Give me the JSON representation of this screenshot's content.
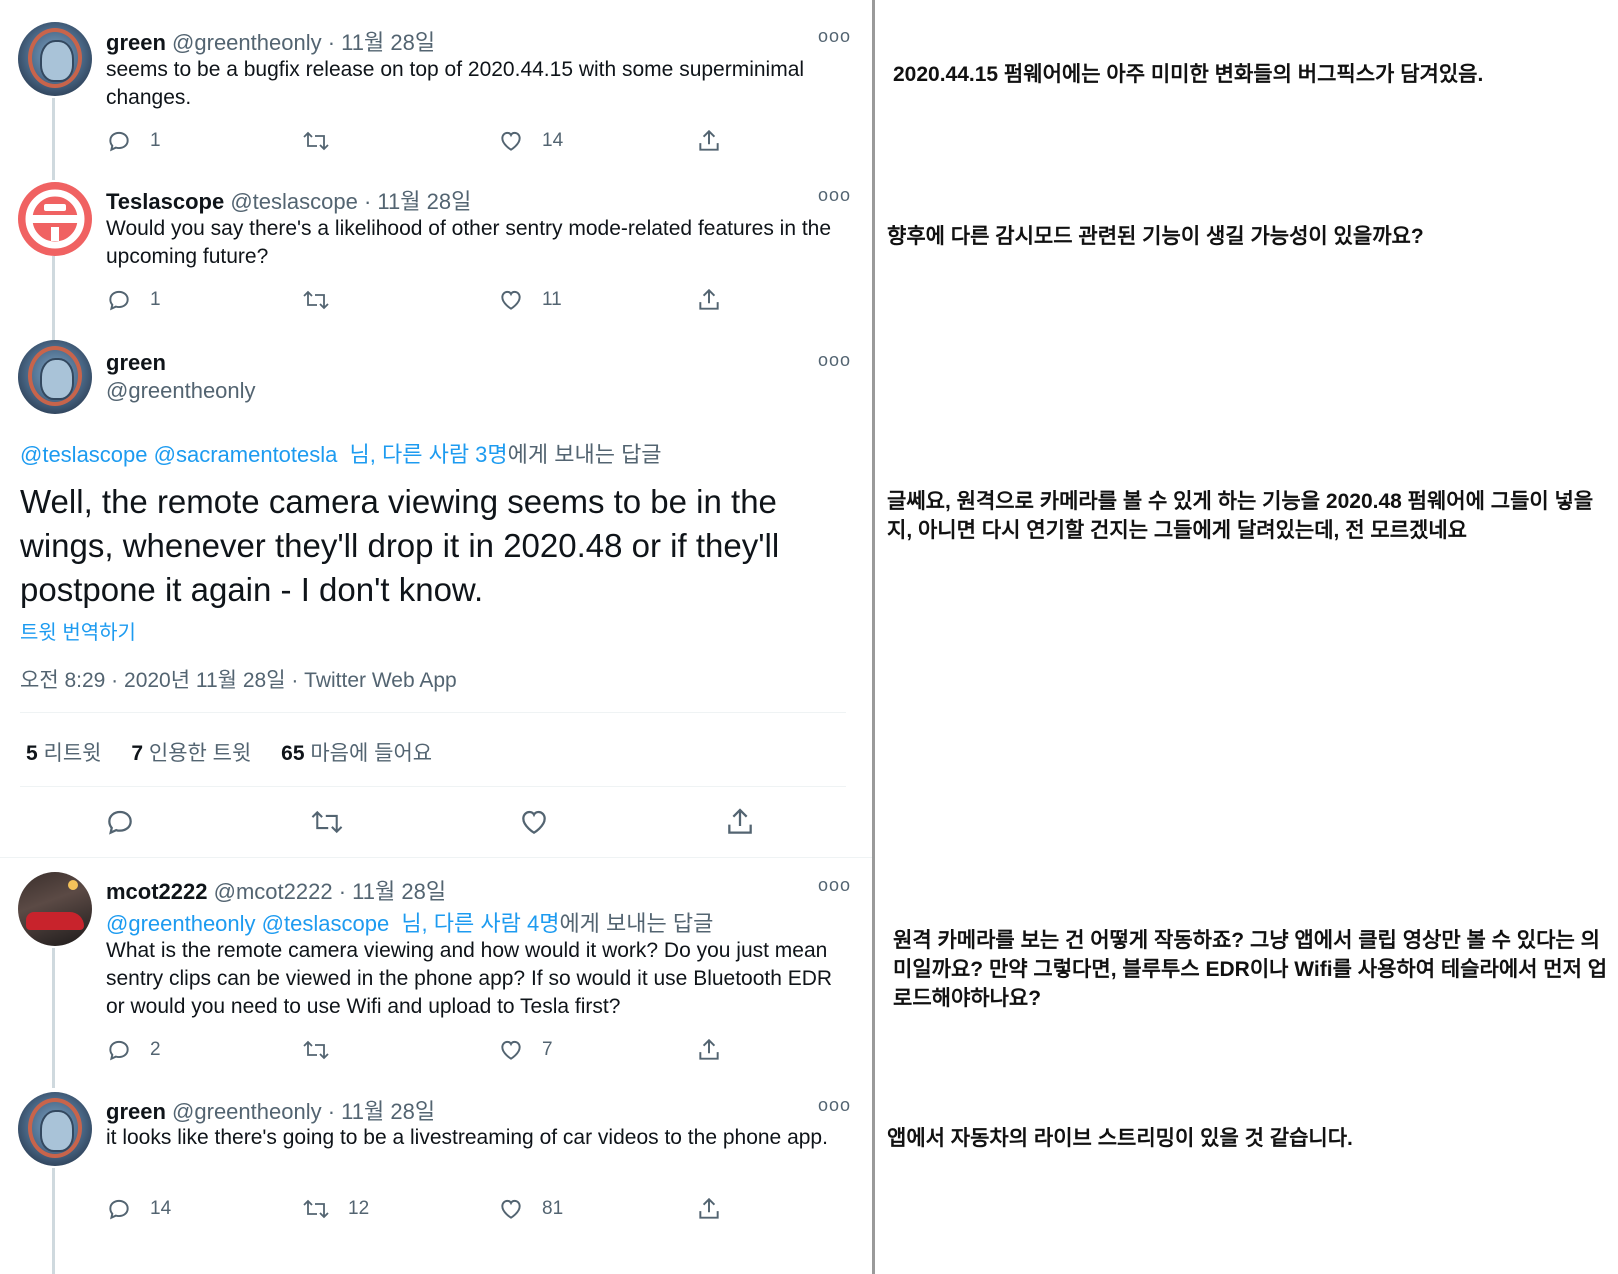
{
  "tweets": {
    "t1": {
      "name": "green",
      "handle": "@greentheonly",
      "date": "11월 28일",
      "text": "seems to be a bugfix release on top of 2020.44.15 with some superminimal changes.",
      "replies": "1",
      "retweets": "",
      "likes": "14"
    },
    "t2": {
      "name": "Teslascope",
      "handle": "@teslascope",
      "date": "11월 28일",
      "text": "Would you say there's a likelihood of other sentry mode-related features in the upcoming future?",
      "replies": "1",
      "retweets": "",
      "likes": "11"
    },
    "main": {
      "name": "green",
      "handle": "@greentheonly",
      "reply_mention1": "@teslascope",
      "reply_mention2": "@sacramentotesla",
      "reply_link": "님, 다른 사람 3명",
      "reply_suffix": "에게 보내는 답글",
      "text": "Well, the remote camera viewing seems to be in the wings, whenever they'll drop it in 2020.48 or if they'll postpone it again - I don't know.",
      "translate": "트윗 번역하기",
      "meta": "오전 8:29 · 2020년 11월 28일 · Twitter Web App",
      "retweet_count": "5",
      "retweet_label": "리트윗",
      "quote_count": "7",
      "quote_label": "인용한 트윗",
      "like_count": "65",
      "like_label": "마음에 들어요"
    },
    "t4": {
      "name": "mcot2222",
      "handle": "@mcot2222",
      "date": "11월 28일",
      "reply_mention1": "@greentheonly",
      "reply_mention2": "@teslascope",
      "reply_link": "님, 다른 사람 4명",
      "reply_suffix": "에게 보내는 답글",
      "text": "What is the remote camera viewing and how would it work? Do you just mean sentry clips can be viewed in the phone app? If so would it use Bluetooth EDR or would you need to use Wifi and upload to Tesla first?",
      "replies": "2",
      "retweets": "",
      "likes": "7"
    },
    "t5": {
      "name": "green",
      "handle": "@greentheonly",
      "date": "11월 28일",
      "text": "it looks like there's going to be a livestreaming of car videos to the phone app.",
      "replies": "14",
      "retweets": "12",
      "likes": "81"
    }
  },
  "translations": {
    "k1": "2020.44.15 펌웨어에는 아주 미미한 변화들의 버그픽스가 담겨있음.",
    "k2": "향후에 다른 감시모드 관련된 기능이 생길 가능성이 있을까요?",
    "k3": "글쎄요, 원격으로 카메라를 볼 수 있게 하는 기능을 2020.48 펌웨어에 그들이 넣을지, 아니면 다시 연기할 건지는 그들에게 달려있는데, 전 모르겠네요",
    "k4": "원격 카메라를 보는 건 어떻게 작동하죠? 그냥 앱에서 클립 영상만 볼 수 있다는 의미일까요? 만약 그렇다면, 블루투스 EDR이나 Wifi를 사용하여 테슬라에서 먼저 업로드해야하나요?",
    "k5": "앱에서 자동차의 라이브 스트리밍이 있을 것 같습니다."
  },
  "separator": " · ",
  "more_glyph": "ooo",
  "icons": {
    "reply": "reply-icon",
    "retweet": "retweet-icon",
    "like": "like-icon",
    "share": "share-icon",
    "more": "more-icon"
  },
  "colors": {
    "link": "#1d9bf0",
    "muted": "#536471",
    "text": "#0f1419",
    "thread_line": "#cfd9de",
    "divider": "#9a9a9a"
  }
}
